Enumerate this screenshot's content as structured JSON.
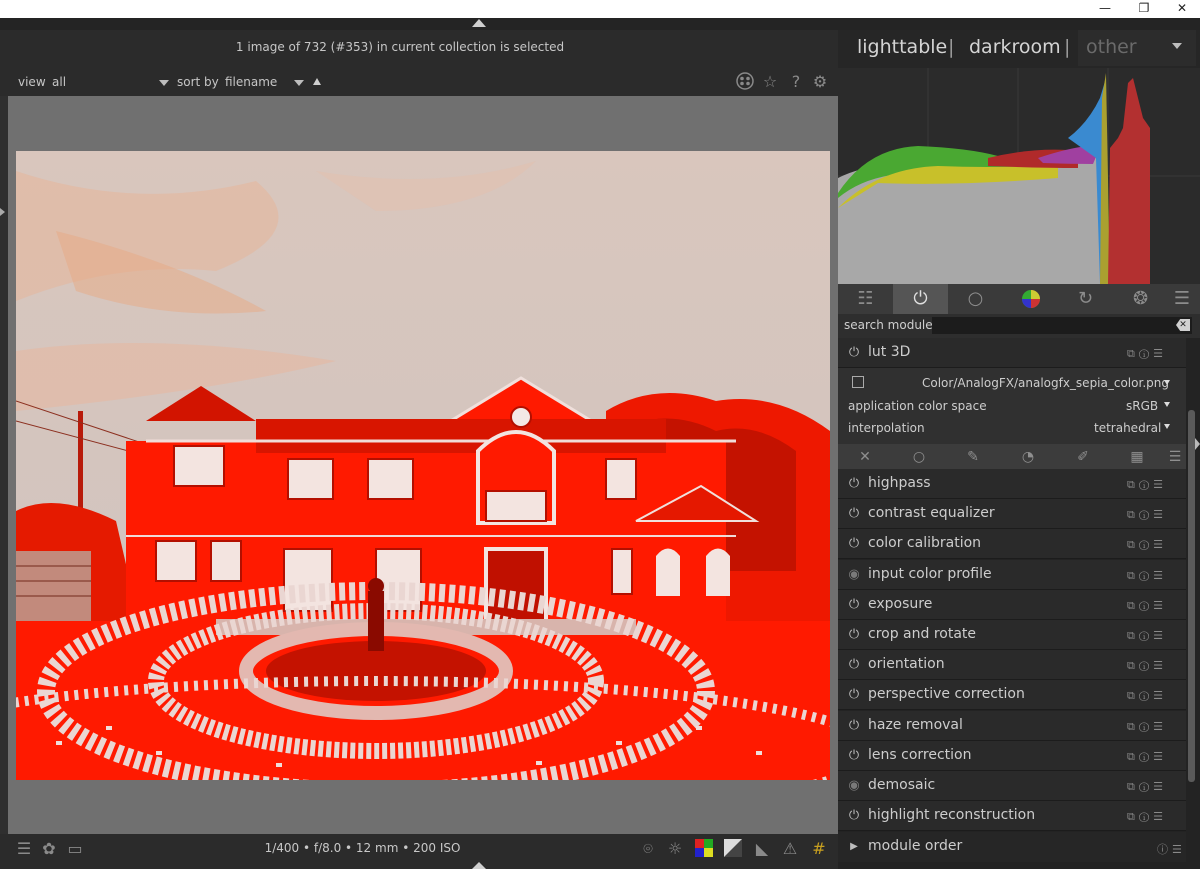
{
  "window": {
    "minimize": "—",
    "restore": "❐",
    "close": "✕"
  },
  "header": {
    "selection_info": "1 image of 732 (#353) in current collection is selected"
  },
  "views": {
    "lighttable": "lighttable",
    "darkroom": "darkroom",
    "other": "other",
    "sep": "|"
  },
  "filter": {
    "view_label": "view",
    "view_value": "all",
    "sort_label": "sort by",
    "sort_value": "filename"
  },
  "bottom": {
    "exif": "1/400 • f/8.0 • 12 mm • 200 ISO"
  },
  "search": {
    "label": "search module",
    "placeholder": ""
  },
  "lut": {
    "name": "lut 3D",
    "file": "Color/AnalogFX/analogfx_sepia_color.png",
    "color_space_label": "application color space",
    "color_space_value": "sRGB",
    "interpolation_label": "interpolation",
    "interpolation_value": "tetrahedral"
  },
  "modules": [
    {
      "name": "highpass",
      "enabled": true
    },
    {
      "name": "contrast equalizer",
      "enabled": true
    },
    {
      "name": "color calibration",
      "enabled": true
    },
    {
      "name": "input color profile",
      "enabled": false
    },
    {
      "name": "exposure",
      "enabled": true
    },
    {
      "name": "crop and rotate",
      "enabled": true
    },
    {
      "name": "orientation",
      "enabled": true
    },
    {
      "name": "perspective correction",
      "enabled": true
    },
    {
      "name": "haze removal",
      "enabled": true
    },
    {
      "name": "lens correction",
      "enabled": true
    },
    {
      "name": "demosaic",
      "enabled": false
    },
    {
      "name": "highlight reconstruction",
      "enabled": true
    }
  ],
  "module_order": {
    "label": "module order"
  },
  "colors": {
    "accent_red": "#ff1a00",
    "panel_bg": "#232323",
    "canvas_bg": "#707070"
  }
}
